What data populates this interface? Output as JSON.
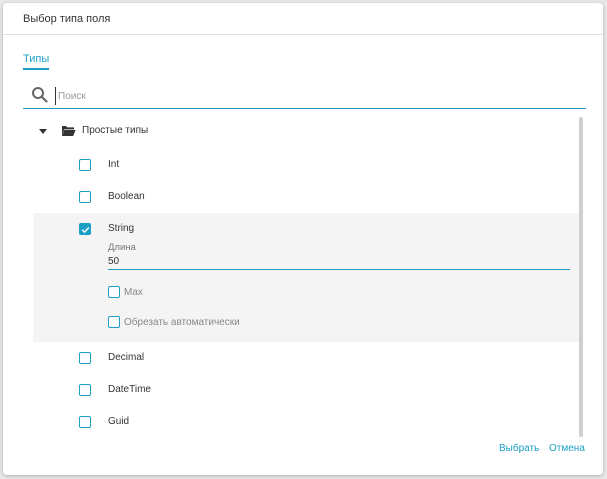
{
  "dialog": {
    "title": "Выбор типа поля"
  },
  "tabs": [
    {
      "label": "Типы",
      "active": true
    }
  ],
  "search": {
    "placeholder": "Поиск",
    "value": ""
  },
  "tree": {
    "group": {
      "label": "Простые типы",
      "expanded": true,
      "icon": "folder-open-icon"
    },
    "items": [
      {
        "label": "Int",
        "checked": false
      },
      {
        "label": "Boolean",
        "checked": false
      },
      {
        "label": "String",
        "checked": true,
        "length_label": "Длина",
        "length_value": "50",
        "options": [
          {
            "label": "Max",
            "checked": false
          },
          {
            "label": "Обрезать автоматически",
            "checked": false
          }
        ]
      },
      {
        "label": "Decimal",
        "checked": false
      },
      {
        "label": "DateTime",
        "checked": false
      },
      {
        "label": "Guid",
        "checked": false
      }
    ]
  },
  "footer": {
    "select_label": "Выбрать",
    "cancel_label": "Отмена"
  },
  "colors": {
    "accent": "#1c9ec5",
    "selected_row_bg": "#f4f4f4"
  }
}
